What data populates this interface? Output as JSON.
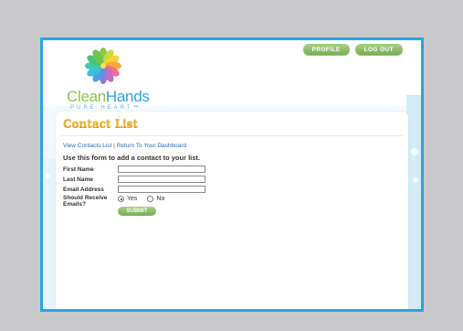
{
  "nav": {
    "profile_label": "PROFILE",
    "logout_label": "LOG OUT"
  },
  "logo": {
    "clean": "Clean",
    "hands": "Hands",
    "tagline": "PURE HEART™"
  },
  "page": {
    "title": "Contact List",
    "links": {
      "view_contacts": "View Contacts List",
      "separator": " | ",
      "dashboard": "Return To Your Dashboard"
    },
    "intro": "Use this form to add a contact to your list."
  },
  "form": {
    "first_name_label": "First Name",
    "last_name_label": "Last Name",
    "email_label": "Email Address",
    "receive_emails_label": "Should Receive Emails?",
    "first_name_value": "",
    "last_name_value": "",
    "email_value": "",
    "yes_label": "Yes",
    "no_label": "No",
    "selected": "Yes",
    "submit_label": "SUBMIT"
  },
  "colors": {
    "frame": "#27a6e3",
    "accent_green": "#8ec54a",
    "title_orange": "#f2b63a"
  }
}
